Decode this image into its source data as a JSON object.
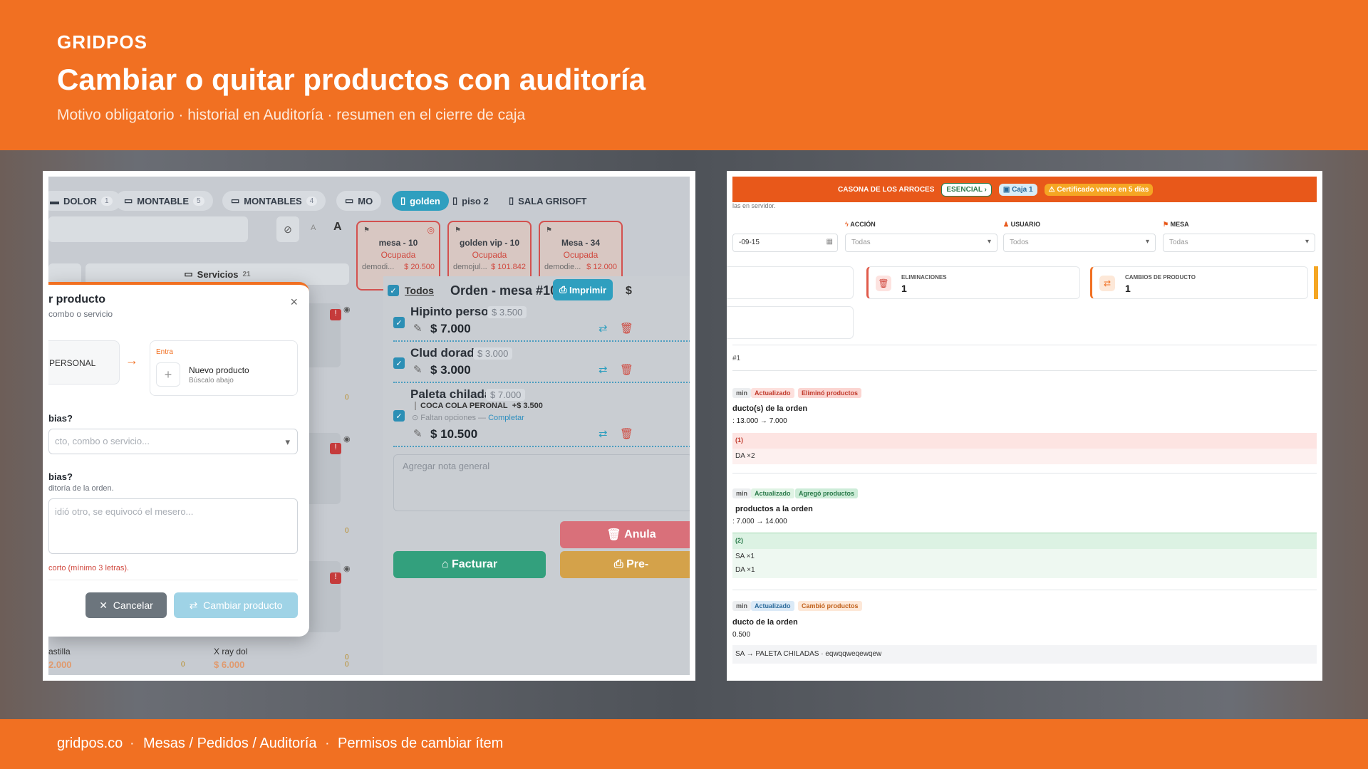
{
  "header": {
    "brand": "GRIDPOS",
    "title": "Cambiar o quitar productos con auditoría",
    "subtitle": "Motivo obligatorio · historial en Auditoría · resumen en el cierre de caja"
  },
  "footer": {
    "site": "gridpos.co",
    "path": "Mesas / Pedidos / Auditoría",
    "perm": "Permisos de cambiar ítem",
    "sep": "·"
  },
  "left_shot": {
    "tabs": [
      {
        "label": "DOLOR",
        "count": "1"
      },
      {
        "label": "MONTABLE",
        "count": "5"
      },
      {
        "label": "MONTABLES",
        "count": "4"
      },
      {
        "label": "MO",
        "count": ""
      },
      {
        "label": "golden",
        "count": ""
      },
      {
        "label": "piso 2",
        "count": ""
      },
      {
        "label": "SALA GRISOFT",
        "count": ""
      }
    ],
    "services": {
      "label": "Servicios",
      "count": "21"
    },
    "tables": [
      {
        "name": "mesa - 10",
        "status": "Ocupada",
        "who": "demodi...",
        "amount": "$ 20.500"
      },
      {
        "name": "golden vip - 10",
        "status": "Ocupada",
        "who": "demojul...",
        "amount": "$ 101.842"
      },
      {
        "name": "Mesa - 34",
        "status": "Ocupada",
        "who": "demodie...",
        "amount": "$ 12.000"
      }
    ],
    "order": {
      "all_label": "Todos",
      "title": "Orden - mesa #10",
      "print_label": "Imprimir",
      "currency": "$",
      "items": [
        {
          "name": "Hipinto personal",
          "unit": "$ 3.500",
          "total": "$ 7.000"
        },
        {
          "name": "Clud dorada",
          "unit": "$ 3.000",
          "total": "$ 3.000"
        },
        {
          "name": "Paleta chiladas",
          "unit": "$ 7.000",
          "total": "$ 10.500",
          "addon": "COCA COLA PERONAL",
          "addon_price": "+$ 3.500",
          "missing": "Faltan opciones —",
          "complete": "Completar"
        }
      ],
      "note_placeholder": "Agregar nota general",
      "cancel_label": "Anula",
      "invoice_label": "Facturar",
      "pre_label": "Pre-"
    },
    "bottom_products": [
      {
        "name": "astilla",
        "price": "2.000",
        "qty": "0"
      },
      {
        "name": "X ray dol",
        "price": "$ 6.000",
        "qty": "0"
      }
    ],
    "zero_badges": [
      "0",
      "0",
      "0"
    ],
    "modal": {
      "title": "r producto",
      "subtitle": "combo o servicio",
      "from_label": "PERSONAL",
      "enter_label": "Entra",
      "new_product": "Nuevo producto",
      "new_product_hint": "Búscalo abajo",
      "q1": "bias?",
      "select_placeholder": "cto, combo o servicio...",
      "q2": "bias?",
      "q2_hint": "ditoría de la orden.",
      "reason_placeholder": "idió otro, se equivocó el mesero...",
      "error": "corto (mínimo 3 letras).",
      "cancel_btn": "Cancelar",
      "confirm_btn": "Cambiar producto"
    }
  },
  "right_shot": {
    "company": "CASONA DE LOS ARROCES",
    "plan": "ESENCIAL",
    "cash": "Caja 1",
    "cert": "Certificado vence en 5 días",
    "server_note": "las en servidor.",
    "filters": [
      {
        "label": "ACCIÓN",
        "value": "Todas"
      },
      {
        "label": "USUARIO",
        "value": "Todos"
      },
      {
        "label": "MESA",
        "value": "Todas"
      }
    ],
    "date_value": "-09-15",
    "stats": [
      {
        "label": "ELIMINACIONES",
        "value": "1"
      },
      {
        "label": "CAMBIOS DE PRODUCTO",
        "value": "1"
      }
    ],
    "order_ref": "#1",
    "entries": [
      {
        "role": "min",
        "state": "Actualizado",
        "action": "Eliminó productos",
        "desc": "ducto(s) de la orden",
        "change": ": 13.000 → 7.000",
        "band1": "(1)",
        "band2": "DA ×2"
      },
      {
        "role": "min",
        "state": "Actualizado",
        "action": "Agregó productos",
        "desc": "productos a la orden",
        "change": ": 7.000 → 14.000",
        "band1": "(2)",
        "band2": "SA ×1",
        "band3": "DA ×1"
      },
      {
        "role": "min",
        "state": "Actualizado",
        "action": "Cambió productos",
        "desc": "ducto de la orden",
        "change": "0.500",
        "band1": "SA → PALETA CHILADAS · eqwqqweqewqew"
      }
    ]
  },
  "colors": {
    "brand": "#f17022",
    "teal": "#2f9fbf",
    "danger": "#d0483e",
    "green": "#2fa779",
    "yellow": "#e0a93a"
  }
}
